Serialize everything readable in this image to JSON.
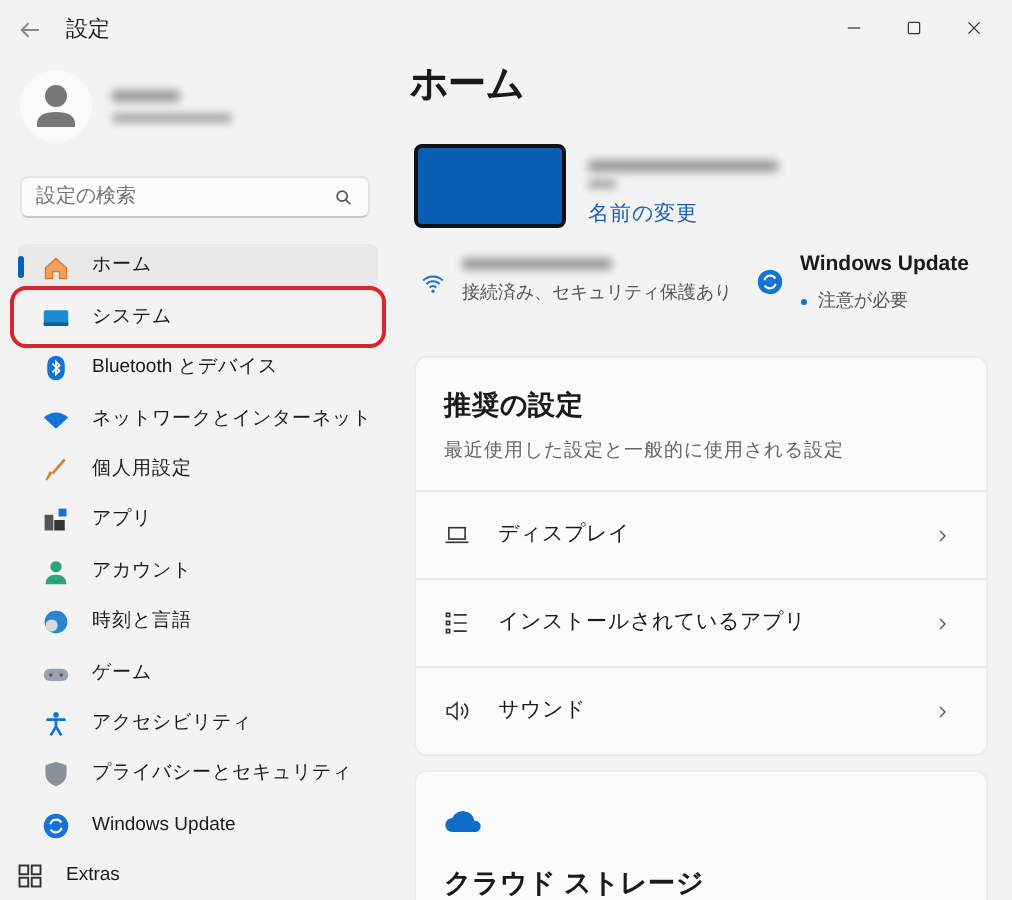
{
  "window": {
    "title": "設定"
  },
  "search": {
    "placeholder": "設定の検索"
  },
  "nav_items": [
    {
      "kind": "home",
      "label": "ホーム",
      "selected": true,
      "highlighted": false
    },
    {
      "kind": "system",
      "label": "システム",
      "selected": false,
      "highlighted": true
    },
    {
      "kind": "bluetooth",
      "label": "Bluetooth とデバイス",
      "selected": false,
      "highlighted": false
    },
    {
      "kind": "network",
      "label": "ネットワークとインターネット",
      "selected": false,
      "highlighted": false
    },
    {
      "kind": "personalize",
      "label": "個人用設定",
      "selected": false,
      "highlighted": false
    },
    {
      "kind": "apps",
      "label": "アプリ",
      "selected": false,
      "highlighted": false
    },
    {
      "kind": "account",
      "label": "アカウント",
      "selected": false,
      "highlighted": false
    },
    {
      "kind": "time",
      "label": "時刻と言語",
      "selected": false,
      "highlighted": false
    },
    {
      "kind": "game",
      "label": "ゲーム",
      "selected": false,
      "highlighted": false
    },
    {
      "kind": "accessibility",
      "label": "アクセシビリティ",
      "selected": false,
      "highlighted": false
    },
    {
      "kind": "privacy",
      "label": "プライバシーとセキュリティ",
      "selected": false,
      "highlighted": false
    },
    {
      "kind": "update",
      "label": "Windows Update",
      "selected": false,
      "highlighted": false
    },
    {
      "kind": "extras",
      "label": "Extras",
      "selected": false,
      "highlighted": false
    }
  ],
  "page_title": "ホーム",
  "device": {
    "rename_link": "名前の変更"
  },
  "status": [
    {
      "kind": "network",
      "detail": "接続済み、セキュリティ保護あり"
    },
    {
      "kind": "update",
      "title": "Windows Update",
      "detail": "注意が必要"
    }
  ],
  "recommended": {
    "title": "推奨の設定",
    "subtitle": "最近使用した設定と一般的に使用される設定",
    "rows": [
      {
        "kind": "display",
        "label": "ディスプレイ"
      },
      {
        "kind": "apps",
        "label": "インストールされているアプリ"
      },
      {
        "kind": "sound",
        "label": "サウンド"
      }
    ]
  },
  "cloud_storage": {
    "title": "クラウド ストレージ"
  }
}
